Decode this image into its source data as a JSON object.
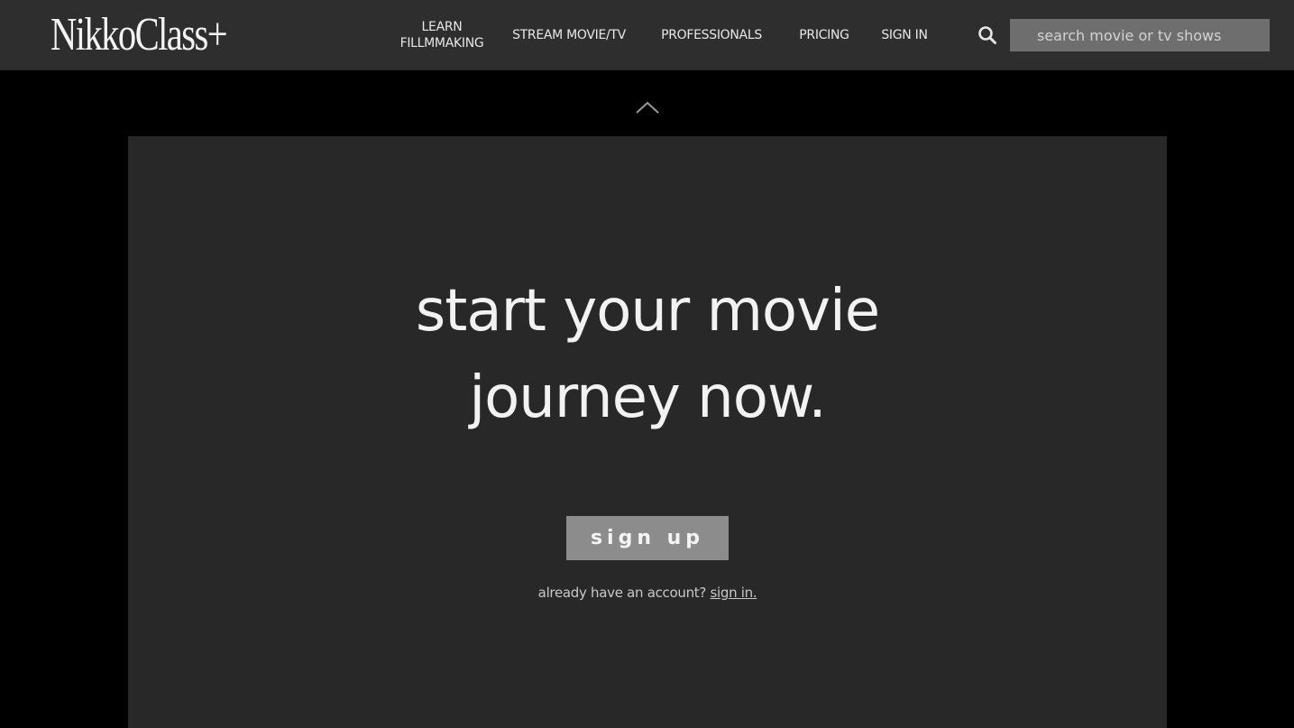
{
  "header": {
    "logo_text": "NikkoClass+",
    "nav": {
      "learn_line1": "LEARN",
      "learn_line2": "FILLMMAKING",
      "stream": "STREAM MOVIE/TV",
      "professionals": "PROFESSIONALS",
      "pricing": "PRICING",
      "sign_in": "SIGN IN"
    },
    "search": {
      "icon": "search-icon",
      "placeholder": "search movie or tv shows"
    }
  },
  "scroll_up": {
    "icon": "chevron-up-icon"
  },
  "hero": {
    "headline_line1": "start your movie",
    "headline_line2": "journey now.",
    "signup_label": "sign up",
    "already_text": "already have an account?",
    "signin_link": "sign in."
  },
  "colors": {
    "page_bg": "#000000",
    "header_bg": "#2e2e2e",
    "panel_bg": "#282828",
    "button_bg": "#8c8c8c",
    "search_bg": "#6e6e6e",
    "text": "#f2f2f2"
  }
}
